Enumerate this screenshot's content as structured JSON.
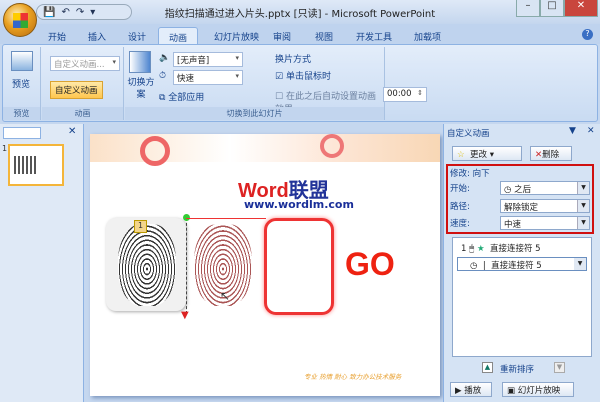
{
  "title": "指纹扫描通过进入片头.pptx [只读] - Microsoft PowerPoint",
  "qat": {
    "save": "💾",
    "undo": "↶",
    "redo": "↷",
    "more": "▾"
  },
  "tabs": [
    "开始",
    "插入",
    "设计",
    "动画",
    "幻灯片放映",
    "审阅",
    "视图",
    "开发工具",
    "加载项"
  ],
  "active_tab": "动画",
  "ribbon": {
    "preview_group": {
      "button": "预览",
      "label": "预览"
    },
    "animation_group": {
      "combo": "自定义动画...",
      "custom_button": "自定义动画",
      "label": "动画"
    },
    "transition_group": {
      "scheme_button": "切换方案",
      "sound": "[无声音]",
      "speed": "快速",
      "apply_all": "全部应用",
      "advance_title": "换片方式",
      "on_click": "单击鼠标时",
      "on_click_checked": true,
      "auto_after": "在此之后自动设置动画效果:",
      "auto_after_checked": false,
      "time": "00:00",
      "label": "切换到此幻灯片"
    }
  },
  "slide": {
    "logo_word": "Word",
    "logo_cn": "联盟",
    "url": "www.wordlm.com",
    "go": "GO",
    "badge": "1",
    "footer": "专业  热情  耐心  致力办公技术服务"
  },
  "task_pane": {
    "title": "自定义动画",
    "change_button": "更改",
    "remove_button": "删除",
    "modify": "修改: 向下",
    "start_label": "开始:",
    "start_value": "之后",
    "path_label": "路径:",
    "path_value": "解除锁定",
    "speed_label": "速度:",
    "speed_value": "中速",
    "items": [
      {
        "index": "1",
        "name": "直接连接符 5"
      },
      {
        "index": "",
        "name": "直接连接符 5"
      }
    ],
    "reorder": "重新排序",
    "play_button": "播放",
    "slideshow_button": "幻灯片放映"
  }
}
